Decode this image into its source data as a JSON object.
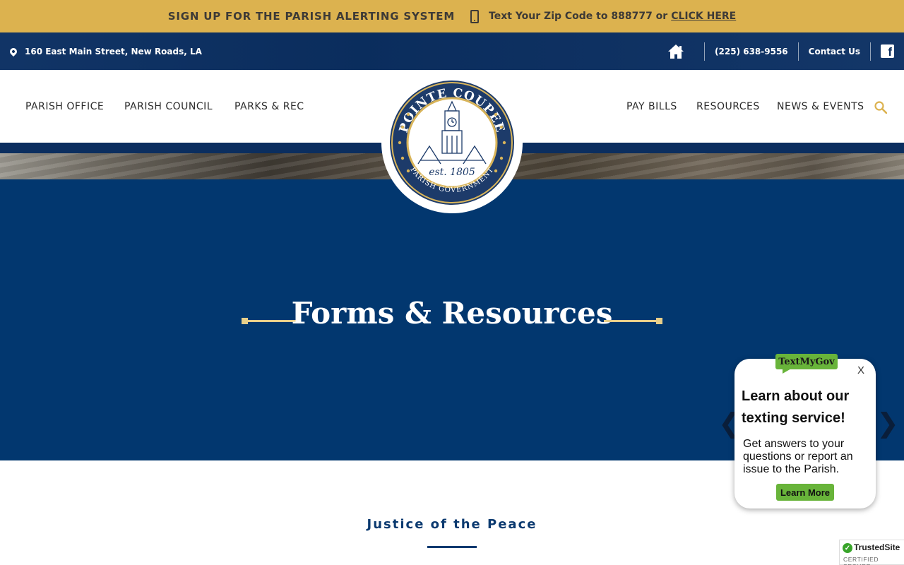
{
  "alert_bar": {
    "title": "SIGN UP FOR THE PARISH ALERTING SYSTEM",
    "text": "Text Your Zip Code to 888777 or",
    "link": "CLICK HERE",
    "phone_icon": "mobile-phone-icon"
  },
  "info_bar": {
    "address": "160 East Main Street, New Roads, LA",
    "phone": "(225) 638-9556",
    "contact": "Contact Us",
    "icons": [
      "map-pin-icon",
      "home-icon",
      "facebook-icon"
    ]
  },
  "nav": {
    "left": [
      "PARISH OFFICE",
      "PARISH COUNCIL",
      "PARKS & REC"
    ],
    "right": [
      "PAY BILLS",
      "RESOURCES",
      "NEWS & EVENTS"
    ],
    "search_icon": "search-icon"
  },
  "logo": {
    "top_text": "POINTE COUPEE",
    "bottom_text": "PARISH GOVERNMENT",
    "est": "est. 1805"
  },
  "hero": {
    "title": "Forms & Resources",
    "prev": "❮",
    "next": "❯"
  },
  "section": {
    "title": "Justice of the Peace"
  },
  "popup": {
    "badge": "TextMyGov",
    "close": "X",
    "heading": "Learn about our texting service!",
    "body": "Get answers to your questions or report an issue to the Parish.",
    "button": "Learn More"
  },
  "trusted_site": {
    "name": "TrustedSite",
    "sub": "CERTIFIED SECURE"
  },
  "colors": {
    "gold": "#dcb24f",
    "navy": "#0b2e5f",
    "hero_blue": "#02376f",
    "accent_line": "#e8cf8a",
    "tmg_green": "#68b43a"
  }
}
